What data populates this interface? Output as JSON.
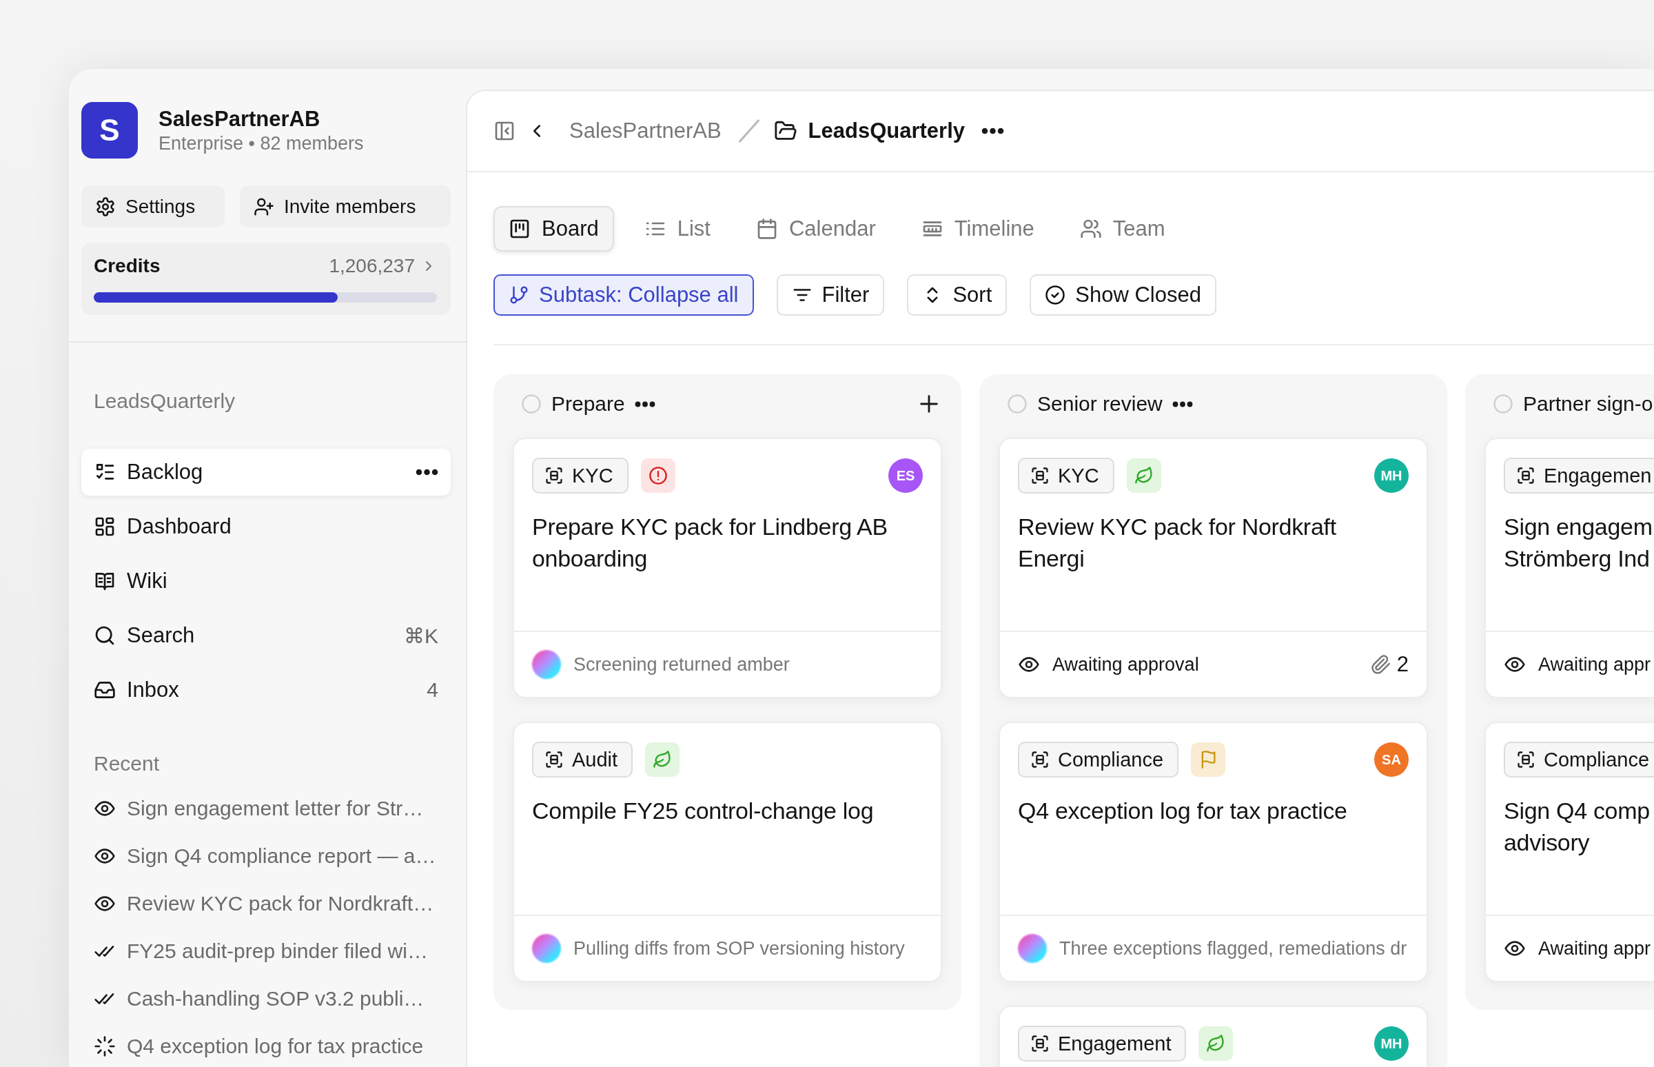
{
  "workspace": {
    "initial": "S",
    "name": "SalesPartnerAB",
    "subtitle": "Enterprise • 82 members"
  },
  "sidebar_buttons": [
    {
      "label": "Settings"
    },
    {
      "label": "Invite members"
    }
  ],
  "credits": {
    "label": "Credits",
    "value": "1,206,237",
    "level": 0.71
  },
  "section_title": "LeadsQuarterly",
  "nav": [
    {
      "label": "Backlog",
      "selected": true
    },
    {
      "label": "Dashboard",
      "selected": false
    },
    {
      "label": "Wiki",
      "selected": false
    },
    {
      "label": "Search",
      "selected": false,
      "shortcut": "⌘K"
    },
    {
      "label": "Inbox",
      "selected": false,
      "count": "4"
    }
  ],
  "recent_title": "Recent",
  "recent": [
    {
      "kind": "watching",
      "label": "Sign engagement letter for Str…"
    },
    {
      "kind": "watching",
      "label": "Sign Q4 compliance report — a…"
    },
    {
      "kind": "watching",
      "label": "Review KYC pack for Nordkraft…"
    },
    {
      "kind": "done",
      "label": "FY25 audit-prep binder filed wi…"
    },
    {
      "kind": "done",
      "label": "Cash-handling SOP v3.2 publi…"
    },
    {
      "kind": "in_progress",
      "label": "Q4 exception log for tax practice"
    }
  ],
  "breadcrumb": [
    "SalesPartnerAB",
    "LeadsQuarterly"
  ],
  "tabs": [
    {
      "label": "Board",
      "selected": true
    },
    {
      "label": "List",
      "selected": false
    },
    {
      "label": "Calendar",
      "selected": false
    },
    {
      "label": "Timeline",
      "selected": false
    },
    {
      "label": "Team",
      "selected": false
    }
  ],
  "toolbar": [
    {
      "label": "Subtask: Collapse all",
      "active": true
    },
    {
      "label": "Filter",
      "active": false
    },
    {
      "label": "Sort",
      "active": false
    },
    {
      "label": "Show Closed",
      "active": false
    }
  ],
  "columns": [
    {
      "name": "Prepare",
      "menu": true,
      "add": true,
      "cards": [
        {
          "tag": "KYC",
          "badge": {
            "kind": "alert"
          },
          "avatar": {
            "initials": "ES",
            "color": "#a855f7"
          },
          "title_lines": [
            "Prepare KYC pack for Lindberg AB",
            "onboarding"
          ],
          "footer": {
            "kind": "activity",
            "text": "Screening returned amber"
          }
        },
        {
          "tag": "Audit",
          "badge": {
            "kind": "leaf"
          },
          "title_lines": [
            "Compile FY25 control-change log"
          ],
          "footer": {
            "kind": "activity",
            "text": "Pulling diffs from SOP versioning history"
          }
        }
      ]
    },
    {
      "name": "Senior review",
      "menu": true,
      "add": false,
      "cards": [
        {
          "tag": "KYC",
          "badge": {
            "kind": "leaf"
          },
          "avatar": {
            "initials": "MH",
            "color": "#14b39c"
          },
          "title_lines": [
            "Review KYC pack for Nordkraft",
            "Energi"
          ],
          "footer": {
            "kind": "status",
            "text": "Awaiting approval",
            "attachments": "2"
          }
        },
        {
          "tag": "Compliance",
          "badge": {
            "kind": "flag"
          },
          "avatar": {
            "initials": "SA",
            "color": "#f07425"
          },
          "title_lines": [
            "Q4 exception log for tax practice"
          ],
          "footer": {
            "kind": "activity",
            "text": "Three exceptions flagged, remediations dr"
          }
        },
        {
          "tag": "Engagement",
          "badge": {
            "kind": "leaf"
          },
          "avatar": {
            "initials": "MH",
            "color": "#14b39c"
          }
        }
      ]
    },
    {
      "name": "Partner sign-o",
      "menu": false,
      "add": false,
      "cards": [
        {
          "tag": "Engagemen",
          "title_lines": [
            "Sign engagem",
            "Strömberg Ind"
          ],
          "footer": {
            "kind": "status",
            "text": "Awaiting appr"
          }
        },
        {
          "tag": "Compliance",
          "title_lines": [
            "Sign Q4 comp",
            "advisory"
          ],
          "footer": {
            "kind": "status",
            "text": "Awaiting appr"
          }
        }
      ]
    }
  ]
}
